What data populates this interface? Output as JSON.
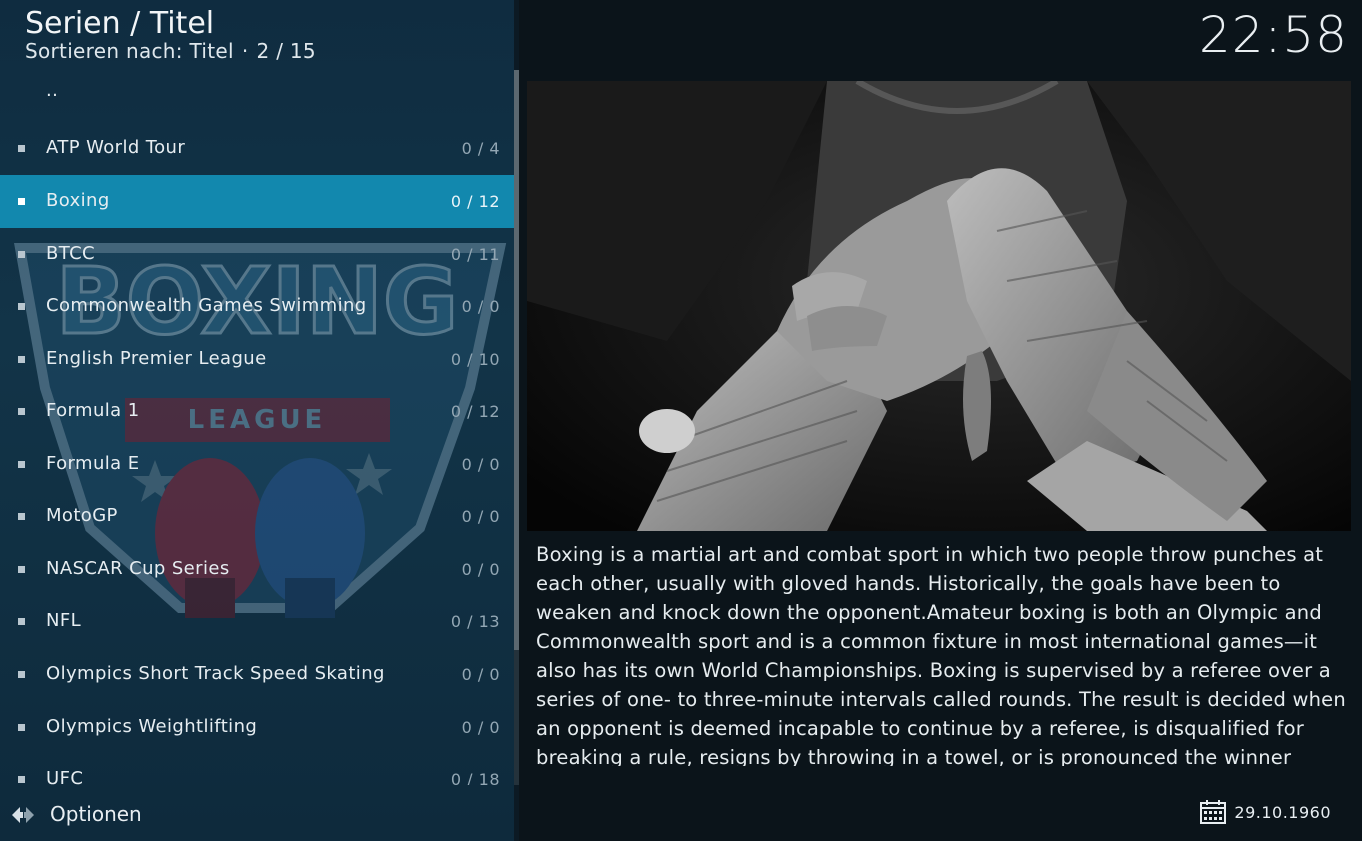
{
  "header": {
    "title": "Serien / Titel",
    "sort_label": "Sortieren nach: Titel",
    "separator": "·",
    "position": "2 / 15"
  },
  "clock": "22:58",
  "list": {
    "parent": "..",
    "items": [
      {
        "label": "ATP World Tour",
        "count": "0 / 4"
      },
      {
        "label": "Boxing",
        "count": "0 / 12",
        "selected": true
      },
      {
        "label": "BTCC",
        "count": "0 / 11"
      },
      {
        "label": "Commonwealth Games Swimming",
        "count": "0 / 0"
      },
      {
        "label": "English Premier League",
        "count": "0 / 10"
      },
      {
        "label": "Formula 1",
        "count": "0 / 12"
      },
      {
        "label": "Formula E",
        "count": "0 / 0"
      },
      {
        "label": "MotoGP",
        "count": "0 / 0"
      },
      {
        "label": "NASCAR Cup Series",
        "count": "0 / 0"
      },
      {
        "label": "NFL",
        "count": "0 / 13"
      },
      {
        "label": "Olympics Short Track Speed Skating",
        "count": "0 / 0"
      },
      {
        "label": "Olympics Weightlifting",
        "count": "0 / 0"
      },
      {
        "label": "UFC",
        "count": "0 / 18"
      }
    ]
  },
  "fanart": {
    "title": "BOXING",
    "subtitle": "LEAGUE"
  },
  "options": {
    "label": "Optionen",
    "icon": "options-arrows-icon"
  },
  "plot": "Boxing is a martial art and combat sport in which two people throw punches at each other, usually with gloved hands. Historically, the goals have been to weaken and knock down the opponent.Amateur boxing is both an Olympic and Commonwealth sport and is a common fixture in most international games—it also has its own World Championships. Boxing is supervised by a referee over a series of one- to three-minute intervals called rounds. The result is decided when an opponent is deemed incapable to continue by a referee, is disqualified for breaking a rule, resigns by throwing in a towel, or is pronounced the winner",
  "premiered": {
    "icon": "calendar-icon",
    "date": "29.10.1960"
  },
  "colors": {
    "accent": "#1288ae",
    "panel": "#123448",
    "background": "#0b141a"
  }
}
